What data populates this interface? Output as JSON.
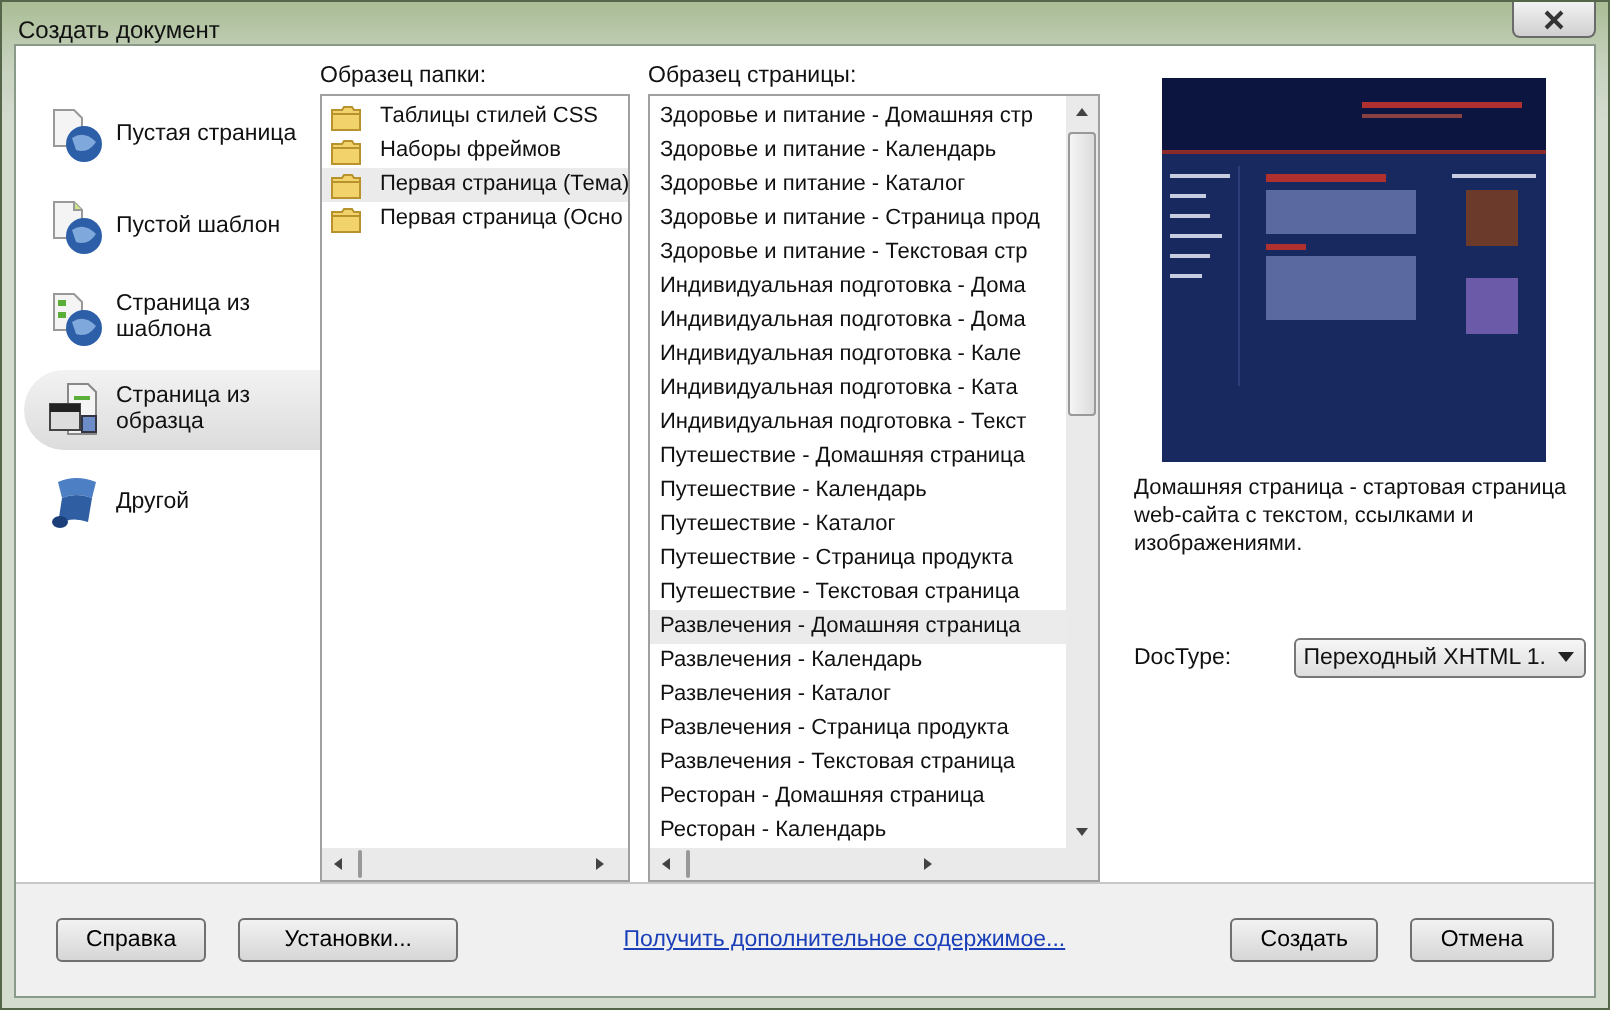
{
  "window": {
    "title": "Создать документ"
  },
  "categories": [
    {
      "label": "Пустая страница",
      "kind": "blank-page",
      "selected": false
    },
    {
      "label": "Пустой шаблон",
      "kind": "blank-template",
      "selected": false
    },
    {
      "label": "Страница из шаблона",
      "kind": "template-page",
      "selected": false
    },
    {
      "label": "Страница из образца",
      "kind": "sample-page",
      "selected": true
    },
    {
      "label": "Другой",
      "kind": "other",
      "selected": false
    }
  ],
  "folder_list": {
    "label": "Образец папки:",
    "items": [
      {
        "label": "Таблицы стилей CSS",
        "selected": false
      },
      {
        "label": "Наборы фреймов",
        "selected": false
      },
      {
        "label": "Первая страница (Тема)",
        "selected": true
      },
      {
        "label": "Первая страница (Осно",
        "selected": false
      }
    ]
  },
  "page_list": {
    "label": "Образец страницы:",
    "items": [
      {
        "label": "Здоровье и питание - Домашняя стр",
        "selected": false
      },
      {
        "label": "Здоровье и питание - Календарь",
        "selected": false
      },
      {
        "label": "Здоровье и питание - Каталог",
        "selected": false
      },
      {
        "label": "Здоровье и питание - Страница прод",
        "selected": false
      },
      {
        "label": "Здоровье и питание - Текстовая стр",
        "selected": false
      },
      {
        "label": "Индивидуальная подготовка - Дома",
        "selected": false
      },
      {
        "label": "Индивидуальная подготовка - Дома",
        "selected": false
      },
      {
        "label": "Индивидуальная подготовка - Кале",
        "selected": false
      },
      {
        "label": "Индивидуальная подготовка - Ката",
        "selected": false
      },
      {
        "label": "Индивидуальная подготовка - Текст",
        "selected": false
      },
      {
        "label": "Путешествие - Домашняя страница",
        "selected": false
      },
      {
        "label": "Путешествие - Календарь",
        "selected": false
      },
      {
        "label": "Путешествие - Каталог",
        "selected": false
      },
      {
        "label": "Путешествие - Страница продукта",
        "selected": false
      },
      {
        "label": "Путешествие - Текстовая страница",
        "selected": false
      },
      {
        "label": "Развлечения - Домашняя страница",
        "selected": true
      },
      {
        "label": "Развлечения - Календарь",
        "selected": false
      },
      {
        "label": "Развлечения - Каталог",
        "selected": false
      },
      {
        "label": "Развлечения - Страница продукта",
        "selected": false
      },
      {
        "label": "Развлечения - Текстовая страница",
        "selected": false
      },
      {
        "label": "Ресторан - Домашняя страница",
        "selected": false
      },
      {
        "label": "Ресторан - Календарь",
        "selected": false
      }
    ]
  },
  "preview": {
    "description": "Домашняя страница - стартовая страница web-сайта с текстом, ссылками и изображениями."
  },
  "doctype": {
    "label": "DocType:",
    "value": "Переходный XHTML 1."
  },
  "footer": {
    "left_buttons": [
      "Справка",
      "Установки..."
    ],
    "link": "Получить дополнительное содержимое...",
    "right_buttons": [
      "Создать",
      "Отмена"
    ]
  }
}
